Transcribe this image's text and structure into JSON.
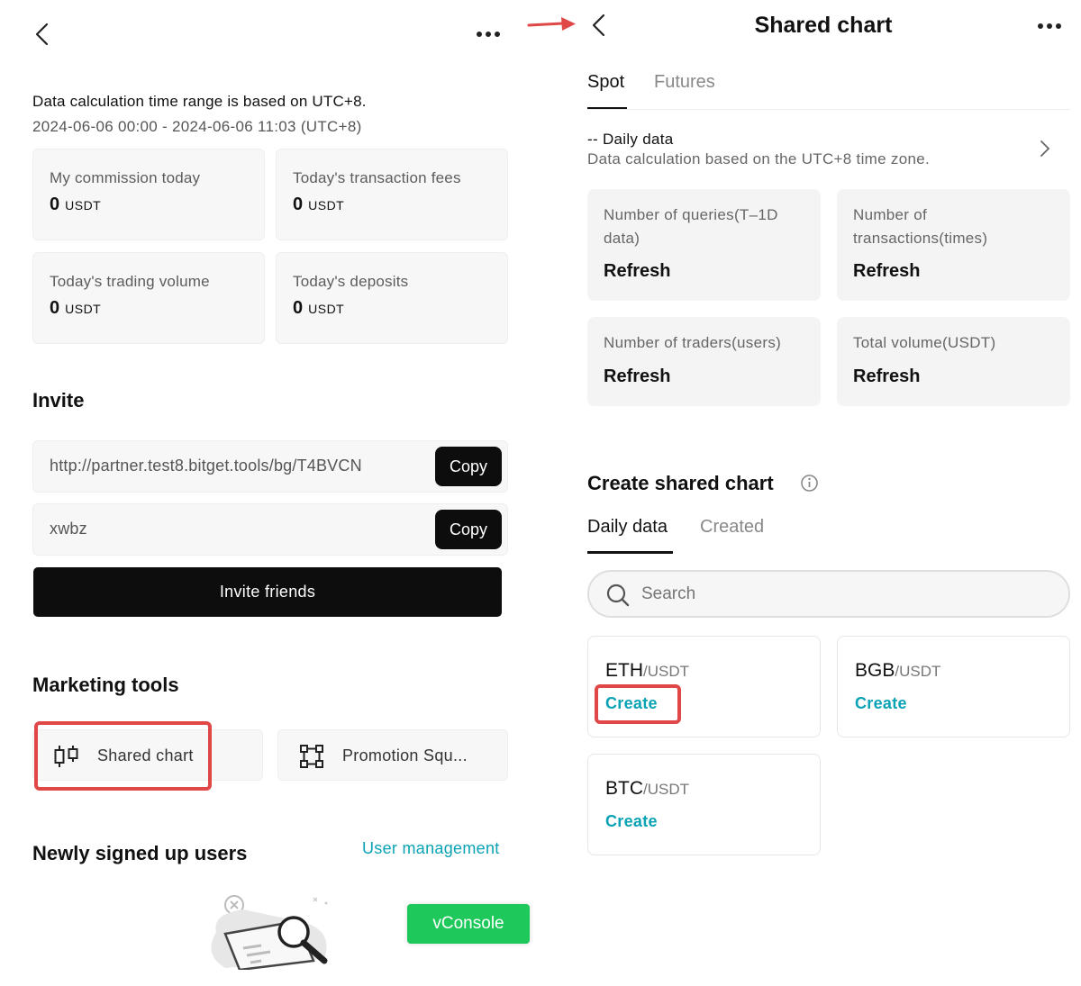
{
  "left": {
    "time_note": "Data calculation time range is based on UTC+8.",
    "time_range": "2024-06-06 00:00 - 2024-06-06 11:03 (UTC+8)",
    "stats": [
      {
        "label": "My commission today",
        "value": "0",
        "unit": "USDT"
      },
      {
        "label": "Today's transaction fees",
        "value": "0",
        "unit": "USDT"
      },
      {
        "label": "Today's trading volume",
        "value": "0",
        "unit": "USDT"
      },
      {
        "label": "Today's deposits",
        "value": "0",
        "unit": "USDT"
      }
    ],
    "invite_title": "Invite",
    "invite_link": "http://partner.test8.bitget.tools/bg/T4BVCN",
    "invite_code": "xwbz",
    "copy_label": "Copy",
    "invite_button": "Invite friends",
    "marketing_title": "Marketing tools",
    "tools": [
      {
        "label": "Shared chart",
        "icon": "candlestick-chart-icon"
      },
      {
        "label": "Promotion Squ...",
        "icon": "frame-nodes-icon"
      }
    ],
    "new_users_title": "Newly signed up users",
    "user_management": "User management",
    "vconsole": "vConsole"
  },
  "right": {
    "title": "Shared chart",
    "tabs": [
      "Spot",
      "Futures"
    ],
    "daily_title": "-- Daily data",
    "daily_note": "Data calculation based on the UTC+8 time zone.",
    "metrics": [
      {
        "label": "Number of queries(T–1D data)",
        "value": "Refresh"
      },
      {
        "label": "Number of transactions(times)",
        "value": "Refresh"
      },
      {
        "label": "Number of traders(users)",
        "value": "Refresh"
      },
      {
        "label": "Total volume(USDT)",
        "value": "Refresh"
      }
    ],
    "create_title": "Create shared chart",
    "sub_tabs": [
      "Daily data",
      "Created"
    ],
    "search_placeholder": "Search",
    "pairs": [
      {
        "base": "ETH",
        "quote": "/USDT",
        "action": "Create"
      },
      {
        "base": "BGB",
        "quote": "/USDT",
        "action": "Create"
      },
      {
        "base": "BTC",
        "quote": "/USDT",
        "action": "Create"
      }
    ]
  },
  "colors": {
    "accent": "#0aa3b5",
    "highlight": "#e04848",
    "vconsole": "#1ec85a",
    "button": "#0d0d0d"
  }
}
